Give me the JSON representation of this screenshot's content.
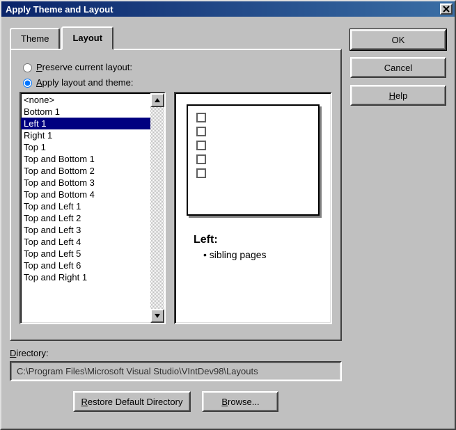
{
  "window": {
    "title": "Apply Theme and Layout"
  },
  "tabs": {
    "theme": "Theme",
    "layout": "Layout",
    "active": "layout"
  },
  "radios": {
    "preserve_prefix": "P",
    "preserve_rest": "reserve current layout:",
    "apply_prefix": "A",
    "apply_rest": "pply layout and theme:"
  },
  "layout_list": {
    "items": [
      "<none>",
      "Bottom 1",
      "Left 1",
      "Right 1",
      "Top 1",
      "Top and Bottom 1",
      "Top and Bottom 2",
      "Top and Bottom 3",
      "Top and Bottom 4",
      "Top and Left 1",
      "Top and Left 2",
      "Top and Left 3",
      "Top and Left 4",
      "Top and Left 5",
      "Top and Left 6",
      "Top and Right 1"
    ],
    "selected_index": 2
  },
  "preview": {
    "heading": "Left:",
    "bullet": "sibling pages"
  },
  "buttons": {
    "ok": "OK",
    "cancel": "Cancel",
    "help_prefix": "H",
    "help_rest": "elp",
    "restore_prefix": "R",
    "restore_rest": "estore Default Directory",
    "browse_prefix": "B",
    "browse_rest": "rowse..."
  },
  "directory": {
    "label_prefix": "D",
    "label_rest": "irectory:",
    "value": "C:\\Program Files\\Microsoft Visual Studio\\VIntDev98\\Layouts"
  }
}
